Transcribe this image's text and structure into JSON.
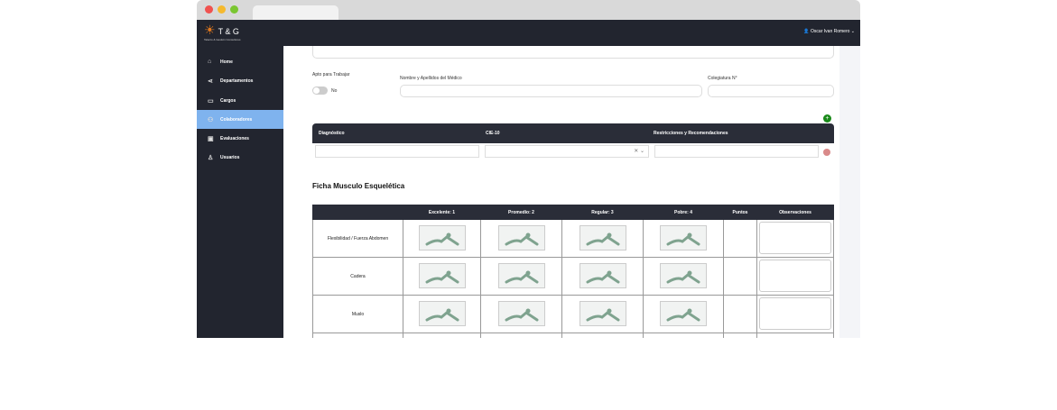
{
  "header": {
    "logo": "T & G",
    "logo_sub": "Talento & Gestión Consultores",
    "user": "Oscar Ivan Romero"
  },
  "sidebar": {
    "items": [
      {
        "label": "Home",
        "icon": "home-icon"
      },
      {
        "label": "Departamentos",
        "icon": "share-icon"
      },
      {
        "label": "Cargos",
        "icon": "briefcase-icon"
      },
      {
        "label": "Colaboradores",
        "icon": "users-icon"
      },
      {
        "label": "Evaluaciones",
        "icon": "clipboard-icon"
      },
      {
        "label": "Usuarios",
        "icon": "user-icon"
      }
    ]
  },
  "form": {
    "apto_label": "Apto para Trabajar",
    "apto_value": "No",
    "medico_label": "Nombre y Apellidos del Médico",
    "colegiatura_label": "Colegiatura N°"
  },
  "diag_table": {
    "headers": [
      "Diagnóstico",
      "CIE-10",
      "Restricciones y Recomendaciones"
    ]
  },
  "section_title": "Ficha Musculo Esquelética",
  "ficha": {
    "headers": [
      "",
      "Excelente: 1",
      "Promedio: 2",
      "Regular: 3",
      "Pobre: 4",
      "Puntos",
      "Observaciones"
    ],
    "rows": [
      "Flexibilidad / Fuerza Abdomen",
      "Cadera",
      "Muslo"
    ]
  }
}
